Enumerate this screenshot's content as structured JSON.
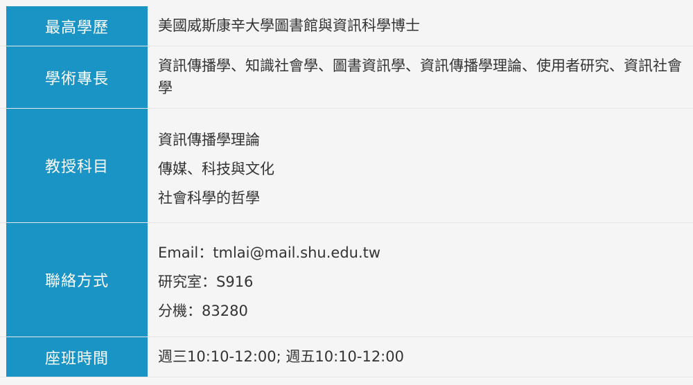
{
  "rows": [
    {
      "label": "最高學歷",
      "values": [
        "美國威斯康辛大學圖書館與資訊科學博士"
      ]
    },
    {
      "label": "學術專長",
      "values": [
        "資訊傳播學、知識社會學、圖書資訊學、資訊傳播學理論、使用者研究、資訊社會學"
      ]
    },
    {
      "label": "教授科目",
      "values": [
        "資訊傳播學理論",
        "傳媒、科技與文化",
        "社會科學的哲學"
      ]
    },
    {
      "label": "聯絡方式",
      "values": [
        "Email：tmlai@mail.shu.edu.tw",
        "研究室：S916",
        "分機：83280"
      ]
    },
    {
      "label": "座班時間",
      "values": [
        "週三10:10-12:00; 週五10:10-12:00"
      ]
    }
  ]
}
